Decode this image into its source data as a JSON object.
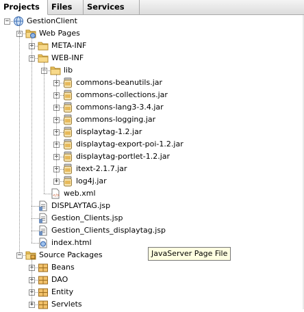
{
  "tabs": [
    {
      "label": "Projects",
      "active": true
    },
    {
      "label": "Files",
      "active": false
    },
    {
      "label": "Services",
      "active": false
    }
  ],
  "tree": [
    {
      "label": "GestionClient",
      "depth": 0,
      "expanded": true,
      "icon": "project-icon"
    },
    {
      "label": "Web Pages",
      "depth": 1,
      "expanded": true,
      "icon": "webpages-folder-icon"
    },
    {
      "label": "META-INF",
      "depth": 2,
      "expanded": false,
      "icon": "folder-icon"
    },
    {
      "label": "WEB-INF",
      "depth": 2,
      "expanded": true,
      "icon": "folder-icon"
    },
    {
      "label": "lib",
      "depth": 3,
      "expanded": true,
      "icon": "folder-icon"
    },
    {
      "label": "commons-beanutils.jar",
      "depth": 4,
      "expanded": false,
      "icon": "jar-icon"
    },
    {
      "label": "commons-collections.jar",
      "depth": 4,
      "expanded": false,
      "icon": "jar-icon"
    },
    {
      "label": "commons-lang3-3.4.jar",
      "depth": 4,
      "expanded": false,
      "icon": "jar-icon"
    },
    {
      "label": "commons-logging.jar",
      "depth": 4,
      "expanded": false,
      "icon": "jar-icon"
    },
    {
      "label": "displaytag-1.2.jar",
      "depth": 4,
      "expanded": false,
      "icon": "jar-icon"
    },
    {
      "label": "displaytag-export-poi-1.2.jar",
      "depth": 4,
      "expanded": false,
      "icon": "jar-icon"
    },
    {
      "label": "displaytag-portlet-1.2.jar",
      "depth": 4,
      "expanded": false,
      "icon": "jar-icon"
    },
    {
      "label": "itext-2.1.7.jar",
      "depth": 4,
      "expanded": false,
      "icon": "jar-icon"
    },
    {
      "label": "log4j.jar",
      "depth": 4,
      "expanded": false,
      "icon": "jar-icon"
    },
    {
      "label": "web.xml",
      "depth": 3,
      "expanded": null,
      "icon": "xml-file-icon"
    },
    {
      "label": "DISPLAYTAG.jsp",
      "depth": 2,
      "expanded": null,
      "icon": "jsp-file-icon"
    },
    {
      "label": "Gestion_Clients.jsp",
      "depth": 2,
      "expanded": null,
      "icon": "jsp-file-icon"
    },
    {
      "label": "Gestion_Clients_displaytag.jsp",
      "depth": 2,
      "expanded": null,
      "icon": "jsp-file-icon"
    },
    {
      "label": "index.html",
      "depth": 2,
      "expanded": null,
      "icon": "html-file-icon"
    },
    {
      "label": "Source Packages",
      "depth": 1,
      "expanded": true,
      "icon": "source-packages-icon"
    },
    {
      "label": "Beans",
      "depth": 2,
      "expanded": false,
      "icon": "package-icon"
    },
    {
      "label": "DAO",
      "depth": 2,
      "expanded": false,
      "icon": "package-icon"
    },
    {
      "label": "Entity",
      "depth": 2,
      "expanded": false,
      "icon": "package-icon"
    },
    {
      "label": "Servlets",
      "depth": 2,
      "expanded": false,
      "icon": "package-icon"
    }
  ],
  "tooltip": "JavaServer Page File"
}
